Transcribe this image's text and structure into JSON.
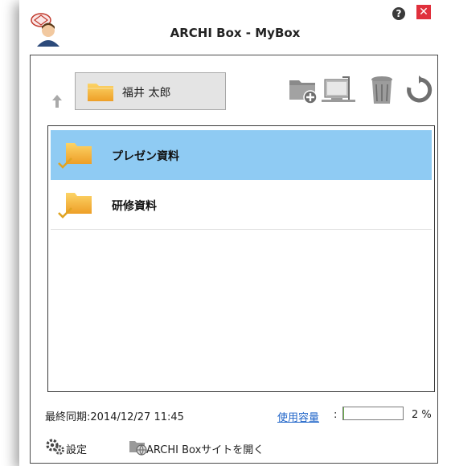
{
  "app": {
    "title": "ARCHI Box - MyBox"
  },
  "titlebar": {
    "help_glyph": "?",
    "close_glyph": "✕"
  },
  "navigation": {
    "current_folder": "福井 太郎"
  },
  "toolbar": {
    "icons": [
      "new-folder-icon",
      "monitor-icon",
      "trash-icon",
      "refresh-icon"
    ]
  },
  "files": [
    {
      "name": "プレゼン資料",
      "selected": true,
      "synced": true
    },
    {
      "name": "研修資料",
      "selected": false,
      "synced": true
    }
  ],
  "status": {
    "last_sync": "最終同期:2014/12/27 11:45",
    "usage_link": "使用容量",
    "usage_colon": ":",
    "usage_percent_value": 2,
    "usage_percent_label": "2 %"
  },
  "footer": {
    "settings_label": "設定",
    "open_site_label": "ARCHI Boxサイトを開く"
  },
  "colors": {
    "selection": "#8fcbf3",
    "link": "#1f64c8",
    "close": "#e0303c",
    "folder": "#f5b93a"
  }
}
